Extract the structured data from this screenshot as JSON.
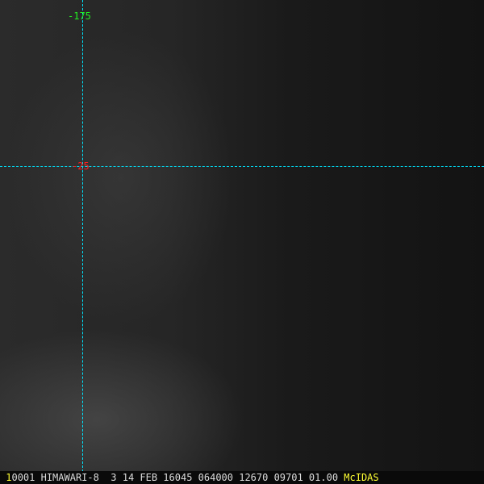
{
  "longitude_label": "-175",
  "latitude_label": "-25",
  "footer": {
    "frame": "1",
    "info": "0001 HIMAWARI-8  3 14 FEB 16045 064000 12670 09701 01.00",
    "brand": "McIDAS"
  },
  "colors": {
    "grid": "#00e5ff",
    "longitude": "#22ee22",
    "latitude": "#ff2020",
    "brand": "#ffff33"
  }
}
